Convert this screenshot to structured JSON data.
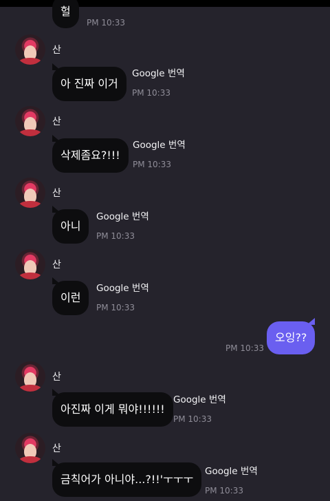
{
  "messages": [
    {
      "text": "헐",
      "time": "PM 10:33"
    },
    {
      "sender": "산",
      "text": "아 진짜 이거",
      "translate": "Google 번역",
      "time": "PM 10:33"
    },
    {
      "sender": "산",
      "text": "삭제좀요?!!!",
      "translate": "Google 번역",
      "time": "PM 10:33"
    },
    {
      "sender": "산",
      "text": "아니",
      "translate": "Google 번역",
      "time": "PM 10:33"
    },
    {
      "sender": "산",
      "text": "이런",
      "translate": "Google 번역",
      "time": "PM 10:33"
    },
    {
      "text": "오잉??",
      "time": "PM 10:33"
    },
    {
      "sender": "산",
      "text": "아진짜 이게 뭐야!!!!!!",
      "translate": "Google 번역",
      "time": "PM 10:33"
    },
    {
      "sender": "산",
      "text": "금칙어가 아니야...?!!'ㅜㅜㅜ",
      "translate": "Google 번역",
      "time": "PM 10:33"
    }
  ]
}
